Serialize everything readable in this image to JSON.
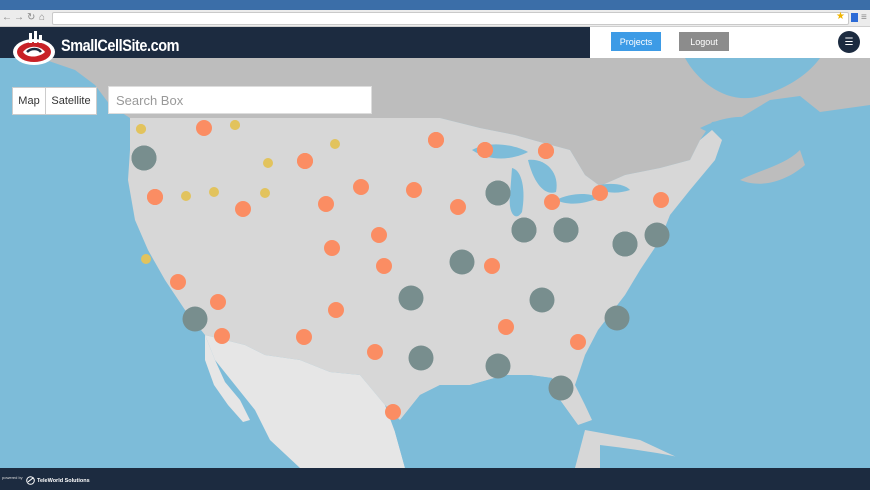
{
  "browser": {
    "nav_icons": [
      "back-arrow-icon",
      "forward-arrow-icon",
      "reload-icon",
      "home-icon"
    ],
    "url": ""
  },
  "app": {
    "brand": "SmallCellSite.com",
    "projects_label": "Projects",
    "logout_label": "Logout",
    "menu_icon": "hamburger-menu-icon"
  },
  "map": {
    "view_map_label": "Map",
    "view_satellite_label": "Satellite",
    "search_placeholder": "Search Box",
    "colors": {
      "water": "#7dbcd9",
      "land_us": "#d7d7d7",
      "land_other": "#bdbdbd",
      "mexico": "#e6e6e6",
      "marker_small": "#e2c35d",
      "marker_orange": "#fb8d63",
      "marker_cluster": "#788e8e"
    },
    "marker_counts": {
      "small": 10,
      "orange": 32,
      "cluster": 19
    }
  },
  "footer": {
    "powered_by": "powered by",
    "company": "TeleWorld Solutions"
  }
}
